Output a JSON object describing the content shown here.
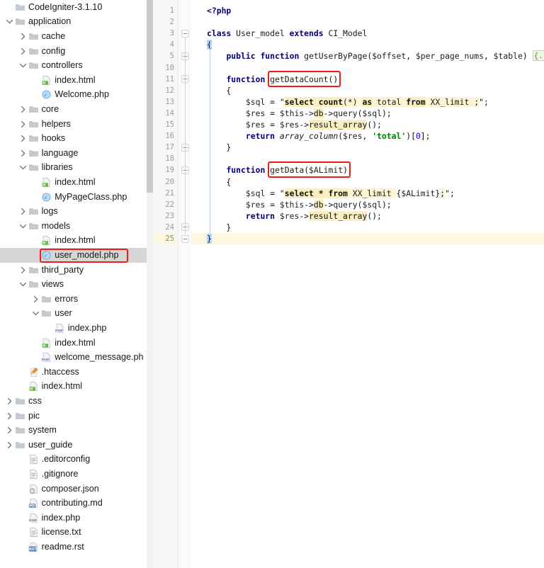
{
  "tree": {
    "scroll_thumb_visible": true,
    "selected_item": "user_model.php",
    "items": [
      {
        "label": "CodeIgniter-3.1.10",
        "depth": 0,
        "icon": "folder-icon",
        "twisty": "none"
      },
      {
        "label": "application",
        "depth": 0,
        "icon": "folder-icon",
        "twisty": "chevron-down-icon"
      },
      {
        "label": "cache",
        "depth": 1,
        "icon": "folder-icon",
        "twisty": "chevron-right-icon"
      },
      {
        "label": "config",
        "depth": 1,
        "icon": "folder-icon",
        "twisty": "chevron-right-icon"
      },
      {
        "label": "controllers",
        "depth": 1,
        "icon": "folder-icon",
        "twisty": "chevron-down-icon"
      },
      {
        "label": "index.html",
        "depth": 2,
        "icon": "html-file-icon",
        "twisty": "none"
      },
      {
        "label": "Welcome.php",
        "depth": 2,
        "icon": "php-class-icon",
        "twisty": "none"
      },
      {
        "label": "core",
        "depth": 1,
        "icon": "folder-icon",
        "twisty": "chevron-right-icon"
      },
      {
        "label": "helpers",
        "depth": 1,
        "icon": "folder-icon",
        "twisty": "chevron-right-icon"
      },
      {
        "label": "hooks",
        "depth": 1,
        "icon": "folder-icon",
        "twisty": "chevron-right-icon"
      },
      {
        "label": "language",
        "depth": 1,
        "icon": "folder-icon",
        "twisty": "chevron-right-icon"
      },
      {
        "label": "libraries",
        "depth": 1,
        "icon": "folder-icon",
        "twisty": "chevron-down-icon"
      },
      {
        "label": "index.html",
        "depth": 2,
        "icon": "html-file-icon",
        "twisty": "none"
      },
      {
        "label": "MyPageClass.php",
        "depth": 2,
        "icon": "php-class-icon",
        "twisty": "none"
      },
      {
        "label": "logs",
        "depth": 1,
        "icon": "folder-icon",
        "twisty": "chevron-right-icon"
      },
      {
        "label": "models",
        "depth": 1,
        "icon": "folder-icon",
        "twisty": "chevron-down-icon"
      },
      {
        "label": "index.html",
        "depth": 2,
        "icon": "html-file-icon",
        "twisty": "none"
      },
      {
        "label": "user_model.php",
        "depth": 2,
        "icon": "php-class-icon",
        "twisty": "none",
        "selected": true
      },
      {
        "label": "third_party",
        "depth": 1,
        "icon": "folder-icon",
        "twisty": "chevron-right-icon"
      },
      {
        "label": "views",
        "depth": 1,
        "icon": "folder-icon",
        "twisty": "chevron-down-icon"
      },
      {
        "label": "errors",
        "depth": 2,
        "icon": "folder-icon",
        "twisty": "chevron-right-icon"
      },
      {
        "label": "user",
        "depth": 2,
        "icon": "folder-icon",
        "twisty": "chevron-down-icon"
      },
      {
        "label": "index.php",
        "depth": 3,
        "icon": "php-file-icon",
        "twisty": "none"
      },
      {
        "label": "index.html",
        "depth": 2,
        "icon": "html-file-icon",
        "twisty": "none"
      },
      {
        "label": "welcome_message.ph",
        "depth": 2,
        "icon": "php-file-icon",
        "twisty": "none"
      },
      {
        "label": ".htaccess",
        "depth": 1,
        "icon": "htaccess-file-icon",
        "twisty": "none"
      },
      {
        "label": "index.html",
        "depth": 1,
        "icon": "html-file-icon",
        "twisty": "none"
      },
      {
        "label": "css",
        "depth": 0,
        "icon": "folder-icon",
        "twisty": "chevron-right-icon"
      },
      {
        "label": "pic",
        "depth": 0,
        "icon": "folder-icon",
        "twisty": "chevron-right-icon"
      },
      {
        "label": "system",
        "depth": 0,
        "icon": "folder-icon",
        "twisty": "chevron-right-icon"
      },
      {
        "label": "user_guide",
        "depth": 0,
        "icon": "folder-icon",
        "twisty": "chevron-right-icon"
      },
      {
        "label": ".editorconfig",
        "depth": 1,
        "icon": "text-file-icon",
        "twisty": "none"
      },
      {
        "label": ".gitignore",
        "depth": 1,
        "icon": "text-file-icon",
        "twisty": "none"
      },
      {
        "label": "composer.json",
        "depth": 1,
        "icon": "json-file-icon",
        "twisty": "none"
      },
      {
        "label": "contributing.md",
        "depth": 1,
        "icon": "md-file-icon",
        "twisty": "none"
      },
      {
        "label": "index.php",
        "depth": 1,
        "icon": "php-file-icon",
        "twisty": "none"
      },
      {
        "label": "license.txt",
        "depth": 1,
        "icon": "text-file-icon",
        "twisty": "none"
      },
      {
        "label": "readme.rst",
        "depth": 1,
        "icon": "rst-file-icon",
        "twisty": "none"
      }
    ]
  },
  "editor": {
    "current_line": 25,
    "line_numbers": [
      1,
      2,
      3,
      4,
      5,
      10,
      11,
      12,
      13,
      14,
      15,
      16,
      17,
      18,
      19,
      20,
      21,
      22,
      23,
      24,
      25
    ],
    "collapsed_placeholder": "{...}",
    "lines_text": [
      "<?php",
      "",
      "class User_model extends CI_Model",
      "{",
      "    public function getUserByPage($offset, $per_page_nums, $table) {...}",
      "",
      "    function getDataCount()",
      "    {",
      "        $sql = \"select count(*) as total from XX_limit ;\";",
      "        $res = $this->db->query($sql);",
      "        $res = $res->result_array();",
      "        return array_column($res, 'total')[0];",
      "    }",
      "",
      "    function getData($ALimit)",
      "    {",
      "        $sql = \"select * from XX_limit {$ALimit};\";",
      "        $res = $this->db->query($sql);",
      "        return $res->result_array();",
      "    }",
      "}"
    ],
    "fold_markers": [
      {
        "line_index": 2,
        "state": "expanded"
      },
      {
        "line_index": 4,
        "state": "collapsed"
      },
      {
        "line_index": 6,
        "state": "expanded"
      },
      {
        "line_index": 12,
        "state": "expanded"
      },
      {
        "line_index": 14,
        "state": "expanded"
      },
      {
        "line_index": 19,
        "state": "expanded"
      },
      {
        "line_index": 20,
        "state": "expanded"
      }
    ]
  },
  "annotations": {
    "tree_box_target": "user_model.php",
    "code_box_1_target": "getDataCount()",
    "code_box_2_target": "getData($ALimit)",
    "color": "#f41a1a"
  },
  "colors": {
    "keyword": "#000080",
    "string_highlight": "#fdf4d3",
    "search_highlight": "#fbeec0",
    "current_line": "#fdf8e3",
    "selection": "#bcd6f7",
    "annotation_red": "#f41a1a",
    "tree_selected_bg": "#d6d6d6"
  }
}
